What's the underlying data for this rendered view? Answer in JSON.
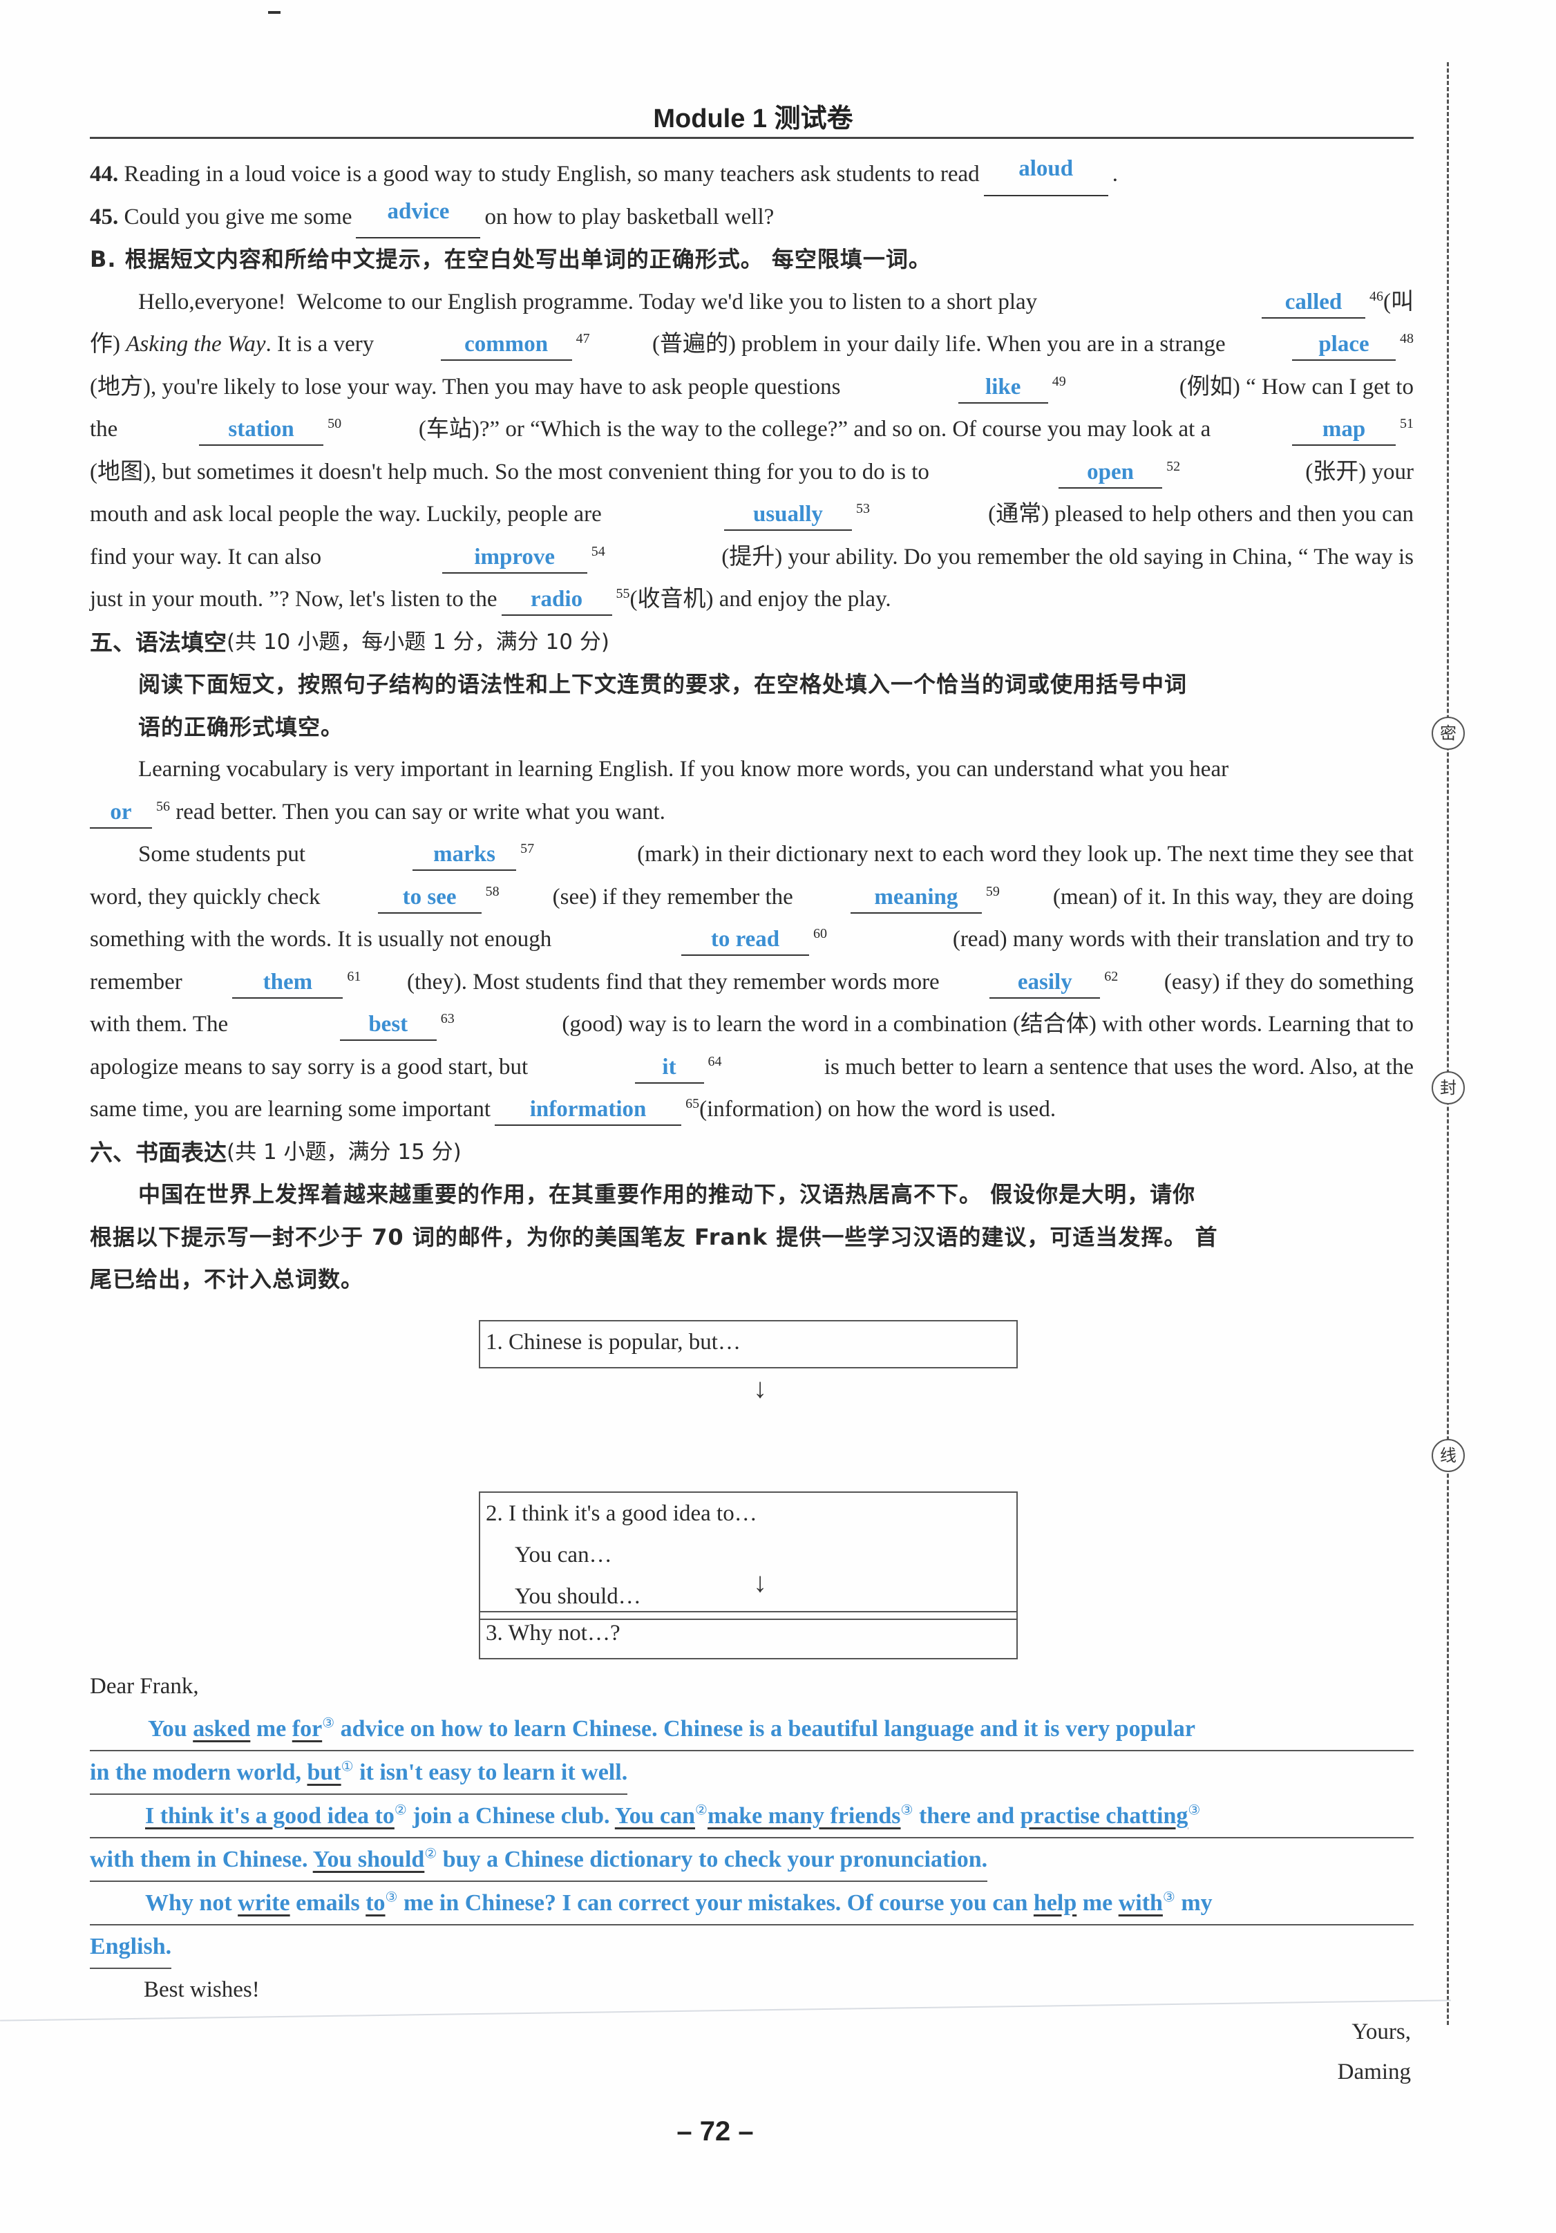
{
  "header": {
    "title": "Module 1  测试卷",
    "page_number": "– 72 –"
  },
  "part_a": {
    "q44": {
      "num": "44.",
      "before": "Reading in a loud voice is a good way to study English, so many teachers ask students to read",
      "answer": "aloud",
      "after": "."
    },
    "q45": {
      "num": "45.",
      "before": "Could you give me some",
      "answer": "advice",
      "after": "on how to play basketball well?"
    }
  },
  "part_b": {
    "instruction": "B. 根据短文内容和所给中文提示，在空白处写出单词的正确形式。 每空限填一词。",
    "lines": [
      [
        "Hello,everyone!  Welcome to our English programme. Today we'd like you to listen to a short play",
        "called",
        "46",
        "(叫"
      ],
      [
        "作) ",
        "Asking the Way",
        ". It is a very",
        "common",
        "47",
        "(普遍的) problem in your daily life. When you are in a strange",
        "place",
        "48"
      ],
      [
        "(地方), you're likely to lose your way. Then you may have to ask people questions",
        "like",
        "49",
        "(例如) “ How can I get to"
      ],
      [
        "the",
        "station",
        "50",
        "(车站)?” or “Which is the way to the college?” and so on. Of course you may look at a",
        "map",
        "51"
      ],
      [
        "(地图), but sometimes it doesn't help much. So the most convenient thing for you to do is to",
        "open",
        "52",
        "(张开) your"
      ],
      [
        "mouth and ask local people the way. Luckily, people are",
        "usually",
        "53",
        "(通常) pleased to help others and then you can"
      ],
      [
        "find your way. It can also",
        "improve",
        "54",
        "(提升) your ability. Do you remember the old saying in China, “ The way is"
      ],
      [
        "just in your mouth. ”? Now, let's listen to the",
        "radio",
        "55",
        "(收音机) and enjoy the play."
      ]
    ]
  },
  "section5": {
    "title": "五、语法填空",
    "score": "(共 10 小题，每小题 1 分，满分 10 分)",
    "instruction_1": "阅读下面短文，按照句子结构的语法性和上下文连贯的要求，在空格处填入一个恰当的词或使用括号中词",
    "instruction_2": "语的正确形式填空。",
    "lines": [
      [
        "Learning vocabulary is very important in learning English. If you know more words, you can understand what you hear"
      ],
      [
        "",
        "or",
        "56",
        "read better. Then you can say or write what you want."
      ],
      [
        "Some students put",
        "marks",
        "57",
        "(mark) in their dictionary next to each word they look up. The next time they see that"
      ],
      [
        "word, they quickly check",
        "to see",
        "58",
        "(see) if they remember the",
        "meaning",
        "59",
        "(mean) of it. In this way, they are doing"
      ],
      [
        "something with the words. It is usually not enough",
        "to read",
        "60",
        "(read) many words with their translation and try to"
      ],
      [
        "remember",
        "them",
        "61",
        "(they). Most students find that they remember words more",
        "easily",
        "62",
        "(easy) if they do something"
      ],
      [
        "with them. The",
        "best",
        "63",
        "(good) way is to learn the word in a combination (结合体) with other words. Learning that to"
      ],
      [
        "apologize means to say sorry is a good start, but",
        "it",
        "64",
        "is much better to learn a sentence that uses the word. Also, at the"
      ],
      [
        "same time, you are learning some important",
        "information",
        "65",
        "(information) on how the word is used."
      ]
    ]
  },
  "section6": {
    "title": "六、书面表达",
    "score": "(共 1 小题，满分 15 分)",
    "prompt_lines": [
      "中国在世界上发挥着越来越重要的作用，在其重要作用的推动下，汉语热居高不下。 假设你是大明，请你",
      "根据以下提示写一封不少于 70 词的邮件，为你的美国笔友 Frank 提供一些学习汉语的建议，可适当发挥。 首",
      "尾已给出，不计入总词数。"
    ],
    "boxes": [
      [
        "1. Chinese is popular, but…"
      ],
      [
        "2.  I think it's a good idea to…",
        "You can…",
        "You should…"
      ],
      [
        "3. Why not…?"
      ]
    ],
    "arrow": "↓",
    "greeting": "Dear Frank,",
    "essay": {
      "p1a": [
        "You ",
        "asked",
        " me ",
        "for",
        "③",
        " advice on how to learn Chinese. Chinese is a beautiful language and it is very popular"
      ],
      "p1b": [
        "in the modern world, ",
        "but",
        "①",
        " it isn't easy to learn it well."
      ],
      "p2a": [
        "I think it's a good idea to",
        "②",
        " join a Chinese club. ",
        "You can",
        "②",
        "make many friends",
        "③",
        " there and ",
        "practise chatting",
        "③"
      ],
      "p2b": [
        "with them in Chinese. ",
        "You should",
        "②",
        " buy a Chinese dictionary to check your pronunciation."
      ],
      "p3a": [
        "Why not ",
        "write",
        " emails ",
        "to",
        "③",
        " me in Chinese?  I can correct your mistakes. Of course you can ",
        "help",
        " me ",
        "with",
        "③",
        " my"
      ],
      "p3b": [
        "English."
      ]
    },
    "sign_off": "Best wishes!",
    "closing_1": "Yours,",
    "closing_2": "Daming"
  },
  "binding_marks": [
    "密",
    "封",
    "线"
  ],
  "colors": {
    "answer": "#3b8fd3",
    "text": "#2a2a2a"
  }
}
